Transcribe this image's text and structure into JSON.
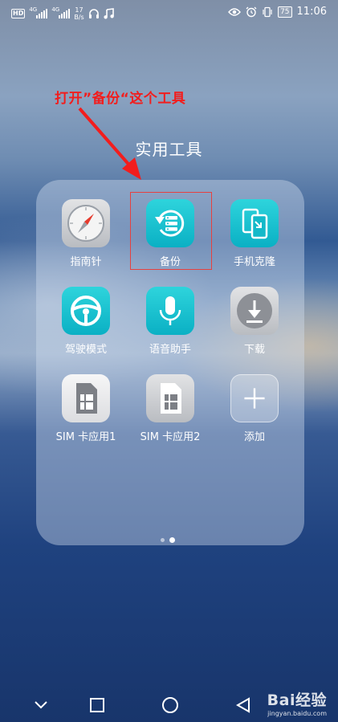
{
  "status_bar": {
    "hd": "HD",
    "net1": "4G",
    "net2": "4G",
    "speed_value": "17",
    "speed_unit": "B/s",
    "battery": "75",
    "time": "11:06"
  },
  "annotation": {
    "text": "打开”备份“这个工具",
    "color": "#f21d1d"
  },
  "folder": {
    "title": "实用工具",
    "apps": [
      {
        "label": "指南针",
        "icon": "compass-icon"
      },
      {
        "label": "备份",
        "icon": "backup-icon"
      },
      {
        "label": "手机克隆",
        "icon": "phone-clone-icon"
      },
      {
        "label": "驾驶模式",
        "icon": "steering-wheel-icon"
      },
      {
        "label": "语音助手",
        "icon": "microphone-icon"
      },
      {
        "label": "下载",
        "icon": "download-icon"
      },
      {
        "label": "SIM 卡应用1",
        "icon": "sim-card-icon"
      },
      {
        "label": "SIM 卡应用2",
        "icon": "sim-card-icon"
      },
      {
        "label": "添加",
        "icon": "plus-icon"
      }
    ],
    "page_count": 2,
    "current_page": 2
  },
  "navigation": {
    "back": "chevron-down-icon",
    "recents": "square-icon",
    "home": "circle-icon",
    "prev": "triangle-left-icon"
  },
  "watermark": {
    "brand": "Bai经验",
    "url": "jingyan.baidu.com"
  }
}
